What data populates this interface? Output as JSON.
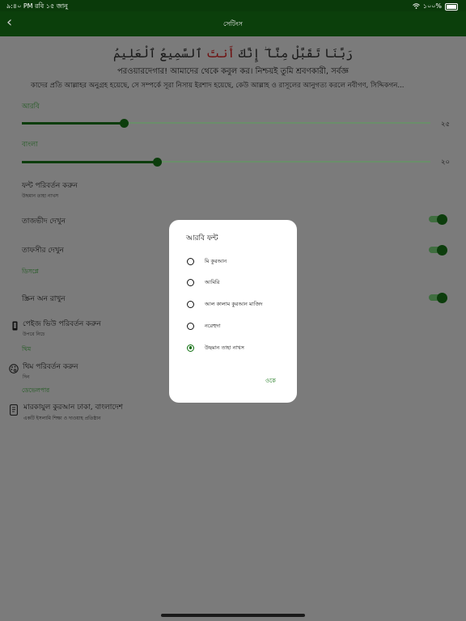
{
  "status_bar": {
    "time_date": "৯:৪০ PM  রবি ১৫ জানু",
    "battery": "১০০%",
    "icons": [
      "wifi-icon",
      "battery-icon"
    ]
  },
  "app_bar": {
    "title": "সেটিংস",
    "back_icon": "chevron-left-icon"
  },
  "ayah": {
    "arabic_pre": "رَبَّنَا تَقَبَّلْ مِنَّآ ۖ إِنَّكَ ",
    "arabic_hl": "أَنتَ",
    "arabic_post": " ٱلسَّمِيعُ ٱلْعَلِيمُ",
    "translation": "পরওয়ারদেগার! আমাদের থেকে কবুল কর। নিশ্চয়ই তুমি শ্রবণকারী, সর্বজ্ঞ",
    "explanation": "কাদের প্রতি আল্লাহর অনুগ্রহ হয়েছে, সে সম্পর্কে সূরা নিসায় ইরশাদ হয়েছে, কেউ আল্লাহ ও রাসূলের আনুগত্য করলে নবীগণ, সিদ্দিকগন..."
  },
  "sliders": {
    "arabic": {
      "label": "আরবি",
      "value_text": "২৫",
      "level": 0.25
    },
    "bangla": {
      "label": "বাংলা",
      "value_text": "২০",
      "level": 0.33
    }
  },
  "font_change": {
    "title": "ফন্ট পরিবর্তন করুন",
    "subtitle": "উছমান তাহা নাখস"
  },
  "tajweed": {
    "title": "তাজভীদ দেখুন",
    "on": true
  },
  "tafsir": {
    "title": "তাফসীর দেখুন",
    "on": true
  },
  "display_section": "ডিসপ্লে",
  "screen_on": {
    "title": "স্ক্রিন অন রাখুন",
    "on": true
  },
  "page_view": {
    "title": "পেইজ ভিউ পরিবর্তন করুন",
    "subtitle": "উপরে নিচে",
    "icon": "phone-icon"
  },
  "theme_section": "থিম",
  "theme_change": {
    "title": "থিম পরিবর্তন করুন",
    "subtitle": "দিন",
    "icon": "palette-icon"
  },
  "developer_section": "ডেভেলপার",
  "developer": {
    "title": "মারকাযুল কুরআন ঢাকা, বাংলাদেশ",
    "subtitle": "একটি ইসলামি শিক্ষা ও দাওয়াহ প্রতিষ্ঠান",
    "icon": "device-icon"
  },
  "dialog": {
    "title": "আরবি ফন্ট",
    "options": [
      {
        "label": "মি কুরআন",
        "selected": false
      },
      {
        "label": "আমিরি",
        "selected": false
      },
      {
        "label": "আল কালাম কুরআন মাজিদ",
        "selected": false
      },
      {
        "label": "নরেহুদা",
        "selected": false
      },
      {
        "label": "উছমান তাহা নাখস",
        "selected": true
      }
    ],
    "ok_label": "ওকে"
  },
  "colors": {
    "app_bar": "#0b3f0b",
    "accent": "#0d6e0d",
    "overlay": "#7b7b7b"
  }
}
